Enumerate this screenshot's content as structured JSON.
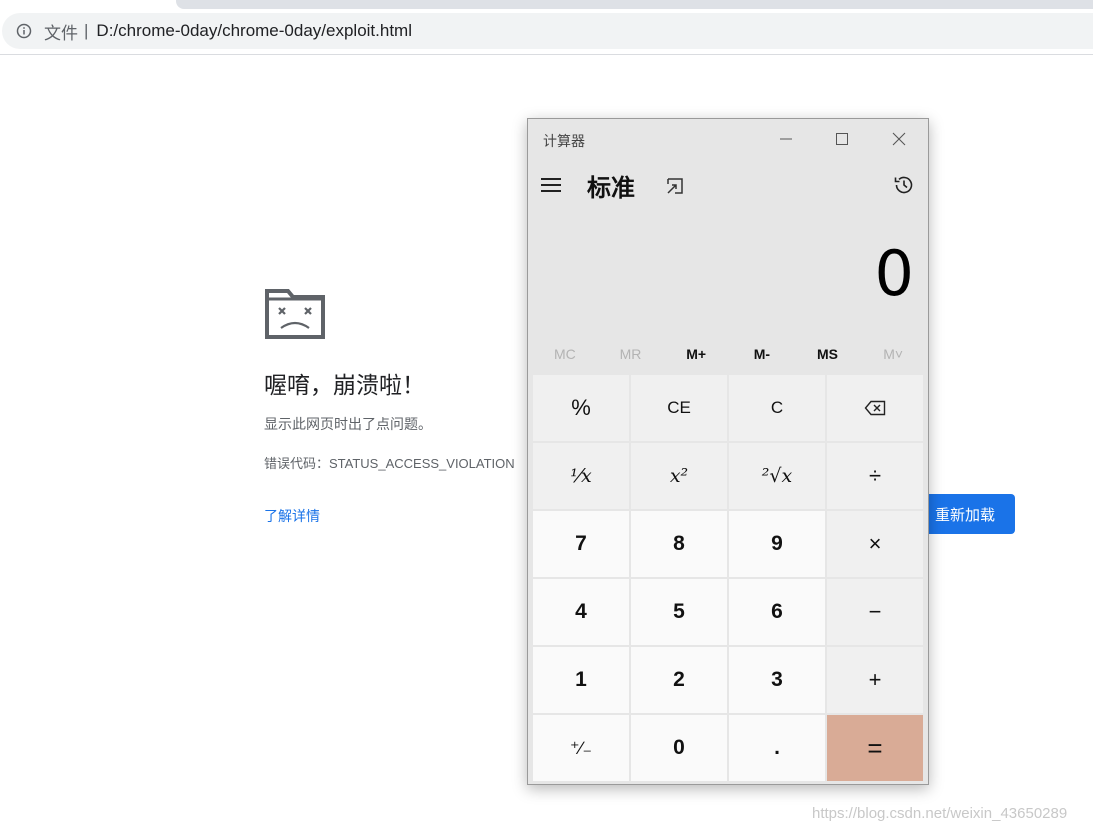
{
  "browser": {
    "origin_chip": "文件",
    "origin_separator": "|",
    "url": "D:/chrome-0day/chrome-0day/exploit.html",
    "info_icon": "info-icon"
  },
  "crash_page": {
    "icon": "sad-folder-icon",
    "title": "喔唷，崩溃啦！",
    "description": "显示此网页时出了点问题。",
    "error_code": "错误代码：STATUS_ACCESS_VIOLATION",
    "learn_more": "了解详情",
    "reload": "重新加载",
    "accent_color": "#1a73e8"
  },
  "calculator": {
    "app_title": "计算器",
    "mode_title": "标准",
    "display_value": "0",
    "icons": [
      "minimize-icon",
      "maximize-icon",
      "close-icon",
      "hamburger-icon",
      "keep-on-top-icon",
      "history-icon",
      "backspace-icon"
    ],
    "memory_buttons": [
      {
        "id": "mc",
        "label": "MC",
        "enabled": false
      },
      {
        "id": "mr",
        "label": "MR",
        "enabled": false
      },
      {
        "id": "mplus",
        "label": "M+",
        "enabled": true
      },
      {
        "id": "mminus",
        "label": "M-",
        "enabled": true
      },
      {
        "id": "ms",
        "label": "MS",
        "enabled": true
      },
      {
        "id": "mlist",
        "label": "M˅",
        "enabled": false
      }
    ],
    "keys": {
      "percent": "%",
      "ce": "CE",
      "c": "C",
      "reciprocal": "⅟x",
      "square": "x²",
      "sqrt": "²√x",
      "divide": "÷",
      "seven": "7",
      "eight": "8",
      "nine": "9",
      "multiply": "×",
      "four": "4",
      "five": "5",
      "six": "6",
      "minus": "−",
      "one": "1",
      "two": "2",
      "three": "3",
      "plus": "+",
      "negate": "⁺∕₋",
      "zero": "0",
      "decimal": ".",
      "equals": "="
    },
    "equals_color": "#d9ab96"
  },
  "watermark": "https://blog.csdn.net/weixin_43650289"
}
